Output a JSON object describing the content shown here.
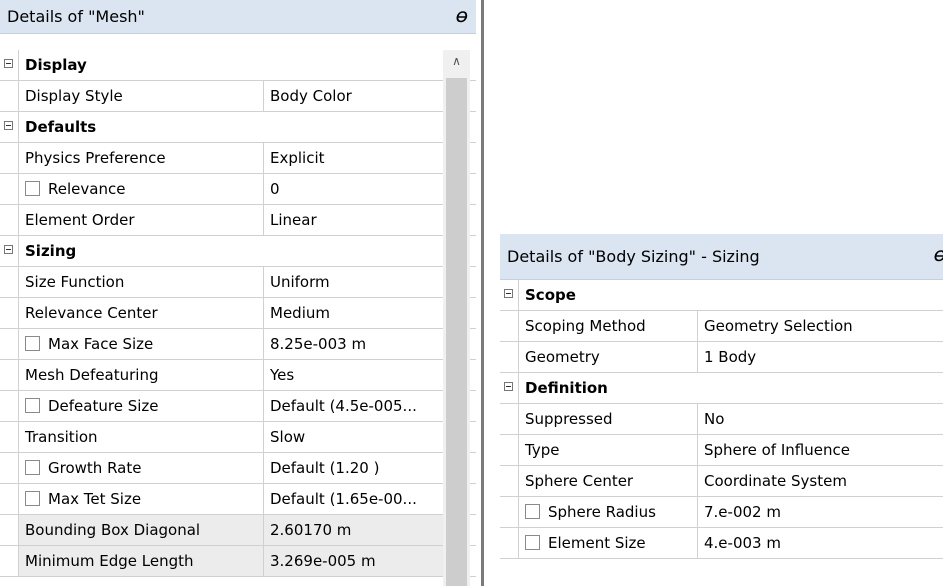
{
  "mesh_panel": {
    "title": "Details of \"Mesh\"",
    "pin_icon": "pin-icon",
    "groups": [
      {
        "label": "Display",
        "rows": [
          {
            "name": "Display Style",
            "value": "Body Color",
            "checkbox": false,
            "shaded": false
          }
        ]
      },
      {
        "label": "Defaults",
        "rows": [
          {
            "name": "Physics Preference",
            "value": "Explicit",
            "checkbox": false,
            "shaded": false
          },
          {
            "name": "Relevance",
            "value": "0",
            "checkbox": true,
            "shaded": false
          },
          {
            "name": "Element Order",
            "value": "Linear",
            "checkbox": false,
            "shaded": false
          }
        ]
      },
      {
        "label": "Sizing",
        "rows": [
          {
            "name": "Size Function",
            "value": "Uniform",
            "checkbox": false,
            "shaded": false
          },
          {
            "name": "Relevance Center",
            "value": "Medium",
            "checkbox": false,
            "shaded": false
          },
          {
            "name": "Max Face Size",
            "value": "8.25e-003 m",
            "checkbox": true,
            "shaded": false
          },
          {
            "name": "Mesh Defeaturing",
            "value": "Yes",
            "checkbox": false,
            "shaded": false
          },
          {
            "name": "Defeature Size",
            "value": "Default (4.5e-005...",
            "checkbox": true,
            "shaded": false
          },
          {
            "name": "Transition",
            "value": "Slow",
            "checkbox": false,
            "shaded": false
          },
          {
            "name": "Growth Rate",
            "value": "Default (1.20 )",
            "checkbox": true,
            "shaded": false
          },
          {
            "name": "Max Tet Size",
            "value": "Default (1.65e-00...",
            "checkbox": true,
            "shaded": false
          },
          {
            "name": "Bounding Box Diagonal",
            "value": "2.60170 m",
            "checkbox": false,
            "shaded": true
          },
          {
            "name": "Minimum Edge Length",
            "value": "3.269e-005 m",
            "checkbox": false,
            "shaded": true
          }
        ]
      }
    ]
  },
  "sizing_panel": {
    "title": "Details of \"Body Sizing\" - Sizing",
    "pin_icon": "pin-icon",
    "groups": [
      {
        "label": "Scope",
        "rows": [
          {
            "name": "Scoping Method",
            "value": "Geometry Selection",
            "checkbox": false,
            "shaded": false
          },
          {
            "name": "Geometry",
            "value": "1 Body",
            "checkbox": false,
            "shaded": false
          }
        ]
      },
      {
        "label": "Definition",
        "rows": [
          {
            "name": "Suppressed",
            "value": "No",
            "checkbox": false,
            "shaded": false
          },
          {
            "name": "Type",
            "value": "Sphere of Influence",
            "checkbox": false,
            "shaded": false
          },
          {
            "name": "Sphere Center",
            "value": "Coordinate System",
            "checkbox": false,
            "shaded": false
          },
          {
            "name": "Sphere Radius",
            "value": "7.e-002 m",
            "checkbox": true,
            "shaded": false
          },
          {
            "name": "Element Size",
            "value": "4.e-003 m",
            "checkbox": true,
            "shaded": false
          }
        ]
      }
    ]
  }
}
